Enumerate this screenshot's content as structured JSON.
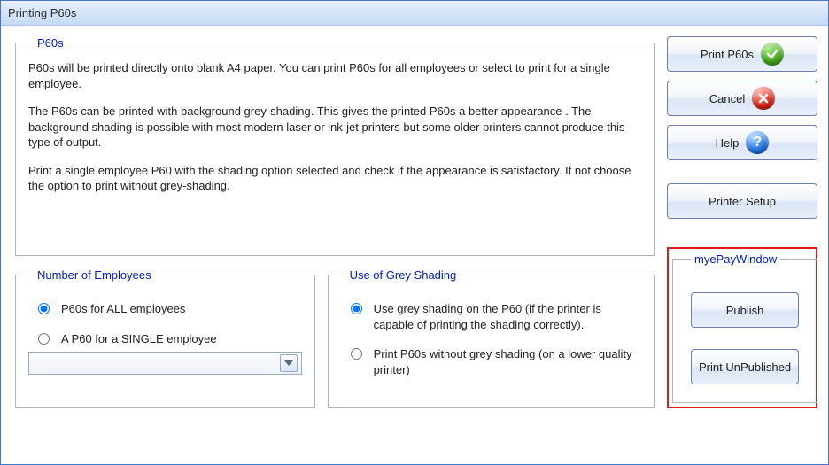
{
  "window": {
    "title": "Printing P60s"
  },
  "p60s": {
    "legend": "P60s",
    "para1": "P60s will be printed directly onto blank A4 paper.  You can print P60s for all employees or select to print for a single employee.",
    "para2": "The P60s can be printed with background grey-shading.  This gives the printed P60s a better appearance .  The background shading is possible with most modern laser or ink-jet printers but some older printers cannot produce this type of output.",
    "para3": "Print a single employee P60 with the shading option selected and check if the appearance is satisfactory.  If not choose the option to print without grey-shading."
  },
  "buttons": {
    "print": "Print P60s",
    "cancel": "Cancel",
    "help": "Help",
    "setup": "Printer Setup"
  },
  "employees": {
    "legend": "Number of Employees",
    "opt_all": "P60s for ALL employees",
    "opt_single": "A P60 for a SINGLE employee",
    "combo_value": ""
  },
  "shading": {
    "legend": "Use of Grey Shading",
    "opt_use": "Use grey shading on the P60 (if the printer is capable of printing the shading correctly).",
    "opt_no": "Print P60s without grey shading (on a lower quality printer)"
  },
  "myepay": {
    "legend": "myePayWindow",
    "publish": "Publish",
    "print_unpub": "Print UnPublished"
  }
}
